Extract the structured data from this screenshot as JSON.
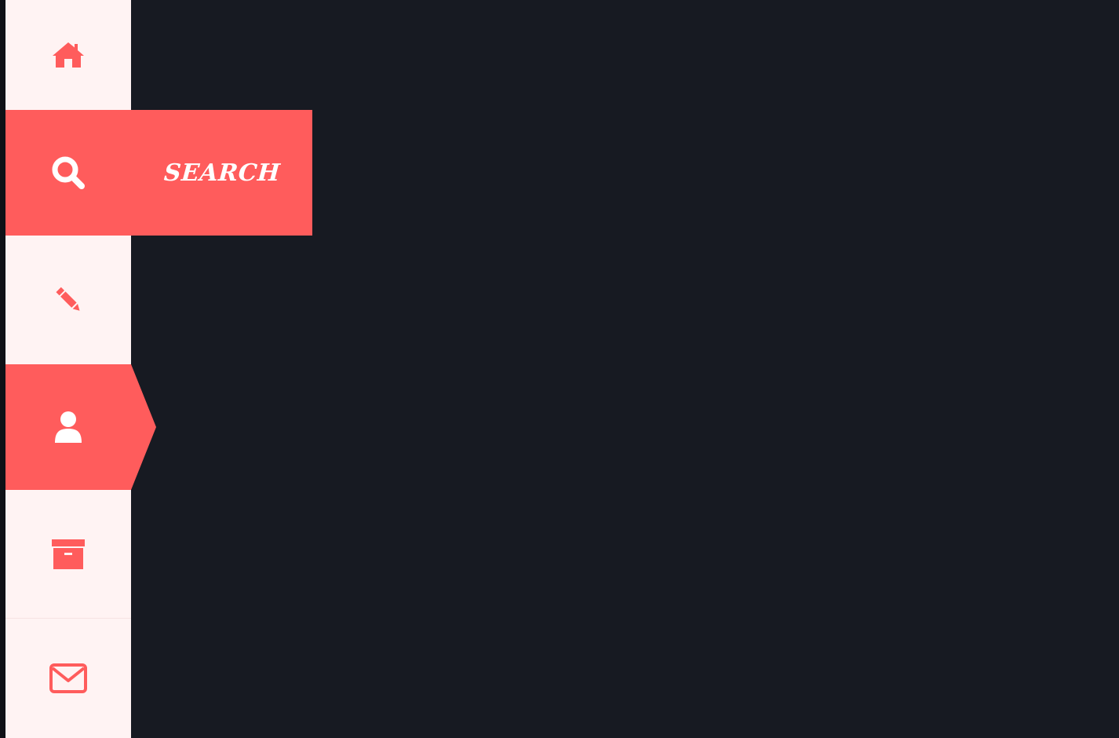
{
  "colors": {
    "background": "#171a22",
    "sidebar": "#fff3f3",
    "accent": "#ff5c5c",
    "icon_active": "#ffffff"
  },
  "nav": {
    "items": [
      {
        "icon": "home-icon",
        "state": "inactive"
      },
      {
        "icon": "search-icon",
        "state": "active",
        "flyout_label": "SEARCH"
      },
      {
        "icon": "pencil-icon",
        "state": "inactive"
      },
      {
        "icon": "user-icon",
        "state": "active"
      },
      {
        "icon": "archive-icon",
        "state": "inactive"
      },
      {
        "icon": "envelope-icon",
        "state": "inactive"
      }
    ]
  }
}
